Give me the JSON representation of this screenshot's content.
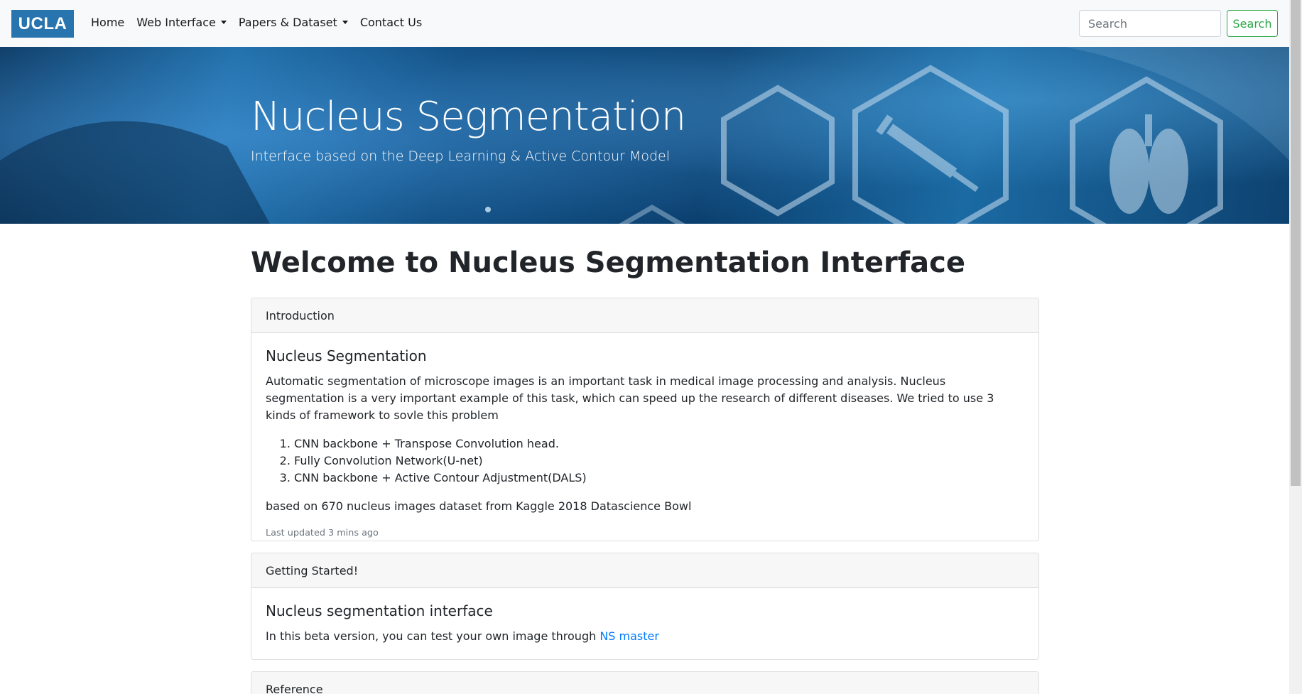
{
  "navbar": {
    "brand": "UCLA",
    "links": [
      {
        "label": "Home",
        "dropdown": false
      },
      {
        "label": "Web Interface",
        "dropdown": true
      },
      {
        "label": "Papers & Dataset",
        "dropdown": true
      },
      {
        "label": "Contact Us",
        "dropdown": false
      }
    ],
    "search_placeholder": "Search",
    "search_button": "Search"
  },
  "hero": {
    "title": "Nucleus Segmentation",
    "subtitle": "Interface based on the Deep Learning & Active Contour Model"
  },
  "main": {
    "title": "Welcome to Nucleus Segmentation Interface",
    "cards": [
      {
        "header": "Introduction",
        "title": "Nucleus Segmentation",
        "text": "Automatic segmentation of microscope images is an important task in medical image processing and analysis. Nucleus segmentation is a very important example of this task, which can speed up the research of different diseases. We tried to use 3 kinds of framework to sovle this problem",
        "list": [
          "CNN backbone + Transpose Convolution head.",
          "Fully Convolution Network(U-net)",
          "CNN backbone + Active Contour Adjustment(DALS)"
        ],
        "footer_text": "based on 670 nucleus images dataset from Kaggle 2018 Datascience Bowl",
        "updated": "Last updated 3 mins ago"
      },
      {
        "header": "Getting Started!",
        "title": "Nucleus segmentation interface",
        "text": "In this beta version, you can test your own image through ",
        "link": "NS master"
      },
      {
        "header": "Reference"
      }
    ]
  },
  "colors": {
    "brand": "#2774ae",
    "link": "#007bff",
    "success": "#28a745"
  }
}
